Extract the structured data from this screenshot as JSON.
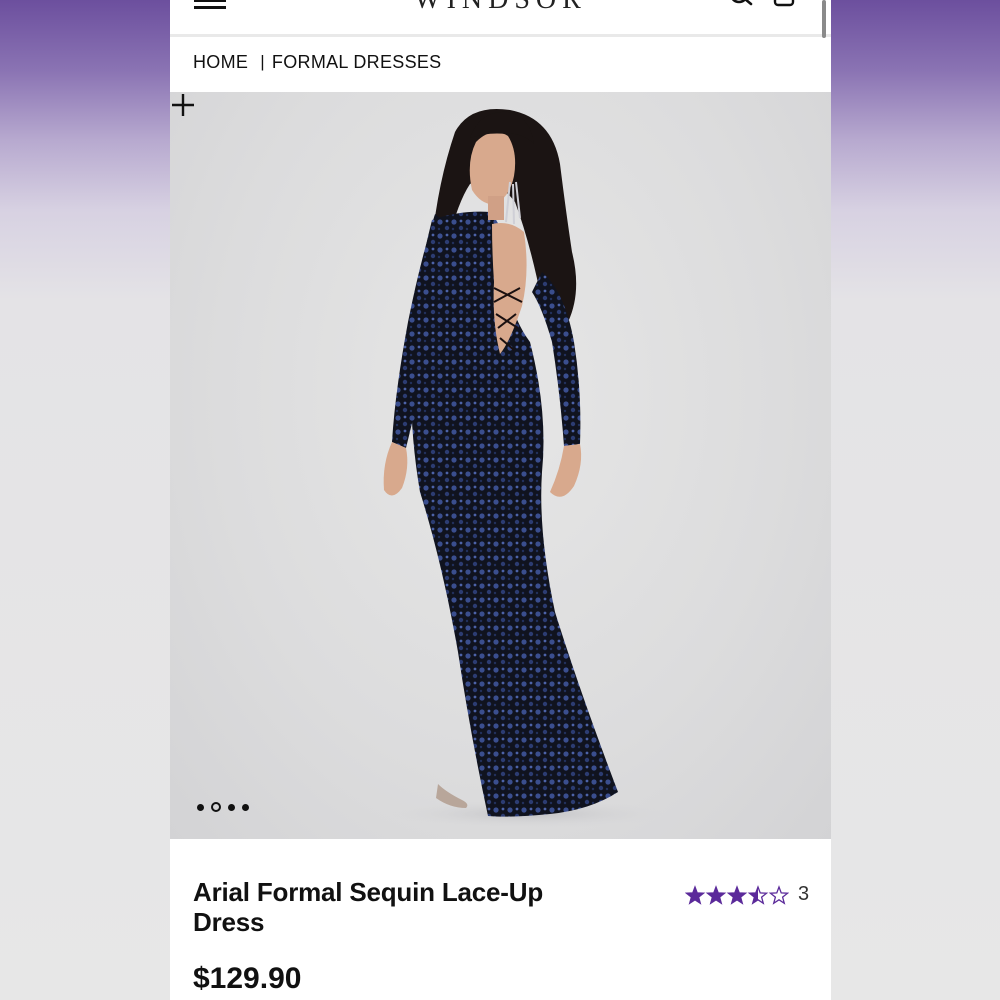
{
  "header": {
    "logo": "WINDSOR",
    "menu_icon": "hamburger-menu-icon",
    "search_icon": "search-icon",
    "bag_icon": "shopping-bag-icon"
  },
  "breadcrumb": {
    "items": [
      "HOME",
      "FORMAL DRESSES"
    ],
    "separator": "|"
  },
  "gallery": {
    "image_count": 4,
    "active_index": 1,
    "plus_icon": "plus-icon"
  },
  "product": {
    "title": "Arial Formal Sequin Lace-Up Dress",
    "price": "$129.90",
    "rating": 3.5,
    "rating_max": 5,
    "review_count": "3",
    "star_color": "#5b2a9a"
  },
  "colors": {
    "accent": "#5b2a9a",
    "background_top": "#6c4f9e"
  }
}
